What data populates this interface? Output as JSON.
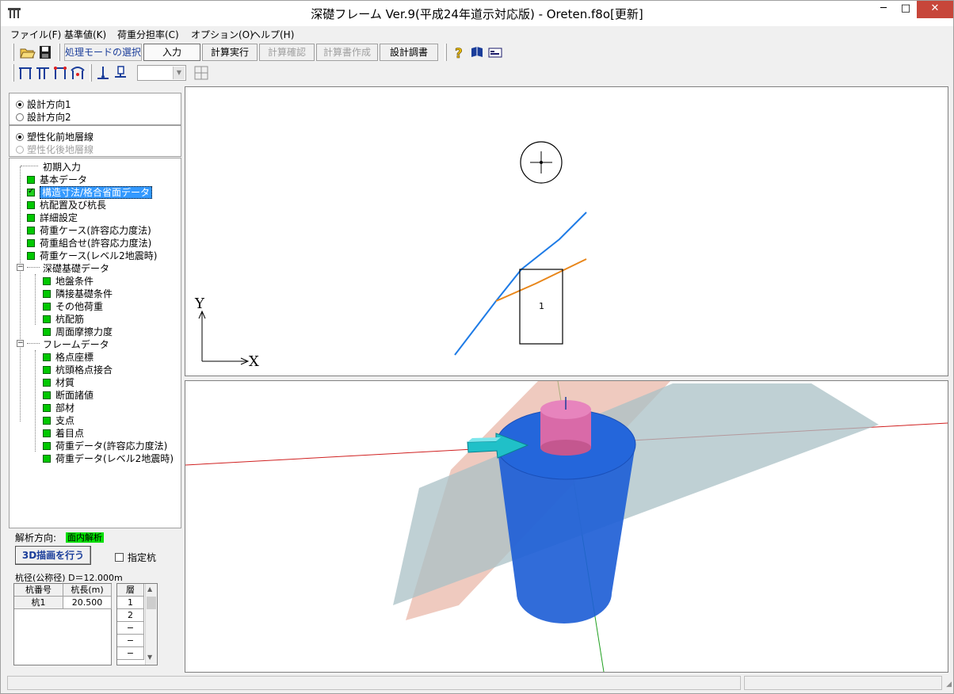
{
  "window": {
    "title": "深礎フレーム Ver.9(平成24年道示対応版) - Oreten.f8o[更新]",
    "minimize": "─",
    "maximize": "□",
    "close": "✕"
  },
  "menu": [
    "ファイル(F)",
    "基準値(K)",
    "荷重分担率(C)",
    "オプション(O)",
    "ヘルプ(H)"
  ],
  "toolbar": {
    "mode_label": "処理モードの選択",
    "input": "入力",
    "calc_run": "計算実行",
    "calc_check": "計算確認",
    "report_create": "計算書作成",
    "design_report": "設計調書",
    "icons": [
      "open-folder-icon",
      "save-icon",
      "help-icon",
      "book-icon",
      "card-icon"
    ]
  },
  "toolbar2": {
    "icons": [
      "frame-icon-1",
      "frame-icon-2",
      "frame-icon-3",
      "frame-icon-4",
      "support-icon",
      "load-icon",
      "grid-icon"
    ],
    "combo_value": ""
  },
  "direction": {
    "option1": "設計方向1",
    "option2": "設計方向2",
    "selected": 1
  },
  "strata": {
    "option1": "塑性化前地層線",
    "option2": "塑性化後地層線",
    "selected": 1
  },
  "tree": {
    "items": [
      {
        "label": "初期入力"
      },
      {
        "label": "基本データ"
      },
      {
        "label": "構造寸法/格合省面データ"
      },
      {
        "label": "杭配置及び杭長"
      },
      {
        "label": "詳細設定"
      },
      {
        "label": "荷重ケース(許容応力度法)"
      },
      {
        "label": "荷重組合せ(許容応力度法)"
      },
      {
        "label": "荷重ケース(レベル2地震時)"
      },
      {
        "label": "深礎基礎データ"
      },
      {
        "label": "地盤条件"
      },
      {
        "label": "隣接基礎条件"
      },
      {
        "label": "その他荷重"
      },
      {
        "label": "杭配筋"
      },
      {
        "label": "周面摩擦力度"
      },
      {
        "label": "フレームデータ"
      },
      {
        "label": "格点座標"
      },
      {
        "label": "杭頭格点接合"
      },
      {
        "label": "材質"
      },
      {
        "label": "断面諸値"
      },
      {
        "label": "部材"
      },
      {
        "label": "支点"
      },
      {
        "label": "着目点"
      },
      {
        "label": "荷重データ(許容応力度法)"
      },
      {
        "label": "荷重データ(レベル2地震時)"
      }
    ]
  },
  "analysis": {
    "label": "解析方向:",
    "value": "面内解析"
  },
  "draw3d_button": "3D描画を行う",
  "specify_pile": "指定杭",
  "pile_diameter": "杭径(公称径) D＝12.000m",
  "pile_table": {
    "headers": [
      "杭番号",
      "杭長(m)"
    ],
    "rows": [
      [
        "杭1",
        "20.500"
      ]
    ]
  },
  "layer_table": {
    "header": "層",
    "rows": [
      "1",
      "2",
      "−",
      "−",
      "−"
    ]
  },
  "view2d": {
    "pile_number": "1",
    "axis_x": "X",
    "axis_y": "Y"
  },
  "colors": {
    "selection": "#3399ff",
    "status_green": "#00c800",
    "line_blue": "#1e7be6",
    "line_orange": "#e8861a",
    "cylinder_blue": "#1f5fd6",
    "pier_pink": "#d96aa8",
    "arrow_cyan": "#20c0c8"
  }
}
